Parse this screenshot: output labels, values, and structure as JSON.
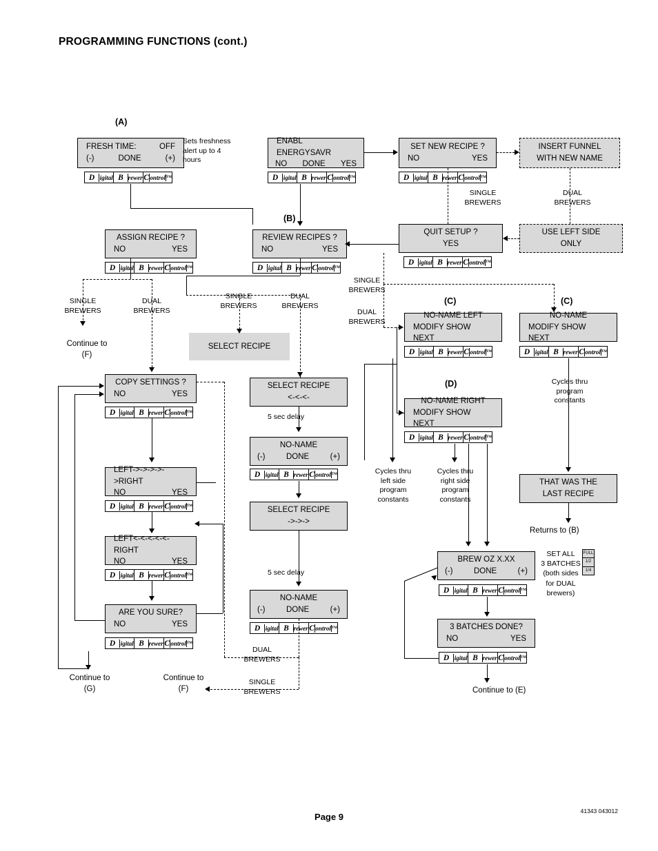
{
  "page": {
    "title": "PROGRAMMING FUNCTIONS (cont.)",
    "page_label": "Page 9",
    "doc_code": "41343 043012"
  },
  "logo": {
    "d": "D",
    "igital": "igital",
    "b": "B",
    "rewer": "rewer",
    "c": "C",
    "ontrol": "ontrol",
    "tm": "TM"
  },
  "tags": {
    "a": "(A)",
    "b": "(B)",
    "c1": "(C)",
    "c2": "(C)",
    "d": "(D)"
  },
  "boxes": {
    "fresh_time": {
      "l1": "FRESH TIME:",
      "r1": "OFF",
      "l2": "(-)",
      "c2": "DONE",
      "r2": "(+)"
    },
    "enabl_energy": {
      "l1": "ENABL ENERGYSAVR",
      "l2": "NO",
      "c2": "DONE",
      "r2": "YES"
    },
    "set_new": {
      "l1": "SET  NEW  RECIPE ?",
      "l2": "NO",
      "r2": "YES"
    },
    "insert_funnel": {
      "l1": "INSERT FUNNEL",
      "l2": "WITH NEW NAME"
    },
    "assign_recipe": {
      "l1": "ASSIGN  RECIPE ?",
      "l2": "NO",
      "r2": "YES"
    },
    "review_recipes": {
      "l1": "REVIEW  RECIPES ?",
      "l2": "NO",
      "r2": "YES"
    },
    "quit_setup": {
      "l1": "QUIT SETUP  ?",
      "l2": "YES"
    },
    "use_left": {
      "l1": "USE LEFT SIDE",
      "l2": "ONLY"
    },
    "select_recipe_plain": {
      "l1": "SELECT  RECIPE"
    },
    "select_recipe_back": {
      "l1": "SELECT  RECIPE",
      "l2": "<-<-<-"
    },
    "select_recipe_fwd": {
      "l1": "SELECT  RECIPE",
      "l2": "->->->"
    },
    "no_name_1": {
      "l1": "NO-NAME",
      "l2": "(-)",
      "c2": "DONE",
      "r2": "(+)"
    },
    "no_name_2": {
      "l1": "NO-NAME",
      "l2": "(-)",
      "c2": "DONE",
      "r2": "(+)"
    },
    "no_name_left": {
      "l1": "NO-NAME LEFT",
      "l2": "MODIFY  SHOW  NEXT"
    },
    "no_name_right": {
      "l1": "NO-NAME RIGHT",
      "l2": "MODIFY  SHOW  NEXT"
    },
    "no_name_c2": {
      "l1": "NO-NAME",
      "l2": "MODIFY  SHOW  NEXT"
    },
    "last_recipe": {
      "l1": "THAT WAS THE",
      "l2": "LAST RECIPE"
    },
    "copy_settings": {
      "l1": "COPY  SETTINGS ?",
      "l2": "NO",
      "r2": "YES"
    },
    "left_right": {
      "l1": "LEFT->->->->->RIGHT",
      "l2": "NO",
      "r2": "YES"
    },
    "right_left": {
      "l1": "LEFT<-<-<-<-<-RIGHT",
      "l2": "NO",
      "r2": "YES"
    },
    "are_you_sure": {
      "l1": "ARE YOU SURE?",
      "l2": "NO",
      "r2": "YES"
    },
    "brew_oz": {
      "l1": "BREW OZ X.XX",
      "l2": "(-)",
      "c2": "DONE",
      "r2": "(+)"
    },
    "batches_done": {
      "l1": "3 BATCHES DONE?",
      "l2": "NO",
      "r2": "YES"
    }
  },
  "labels": {
    "sets_freshness": "Sets freshness\nalert up to 4\nhours",
    "single_brewers_1": "SINGLE\nBREWERS",
    "dual_brewers_1": "DUAL\nBREWERS",
    "single_brewers_2": "SINGLE\nBREWERS",
    "dual_brewers_2": "DUAL\nBREWERS",
    "single_brewers_3": "SINGLE\nBREWERS",
    "dual_brewers_3": "DUAL\nBREWERS",
    "single_brewers_4": "SINGLE\nBREWERS",
    "dual_brewers_4": "DUAL\nBREWERS",
    "dual_brewers_5": "DUAL\nBREWERS",
    "single_brewers_5": "SINGLE\nBREWERS",
    "continue_f_top": "Continue to\n(F)",
    "continue_g": "Continue to\n(G)",
    "continue_f_bottom": "Continue to\n(F)",
    "continue_e": "Continue to (E)",
    "returns_b": "Returns to (B)",
    "delay_1": "5 sec delay",
    "delay_2": "5 sec delay",
    "cycles_left": "Cycles thru\nleft side\nprogram\nconstants",
    "cycles_right": "Cycles thru\nright side\nprogram\nconstants",
    "cycles_prog": "Cycles thru\nprogram\nconstants",
    "set_all": "SET ALL\n3 BATCHES\n(both sides\nfor DUAL\nbrewers)",
    "batch_icon": {
      "full": "FULL",
      "half": "1/2",
      "quarter": "1/4"
    }
  }
}
